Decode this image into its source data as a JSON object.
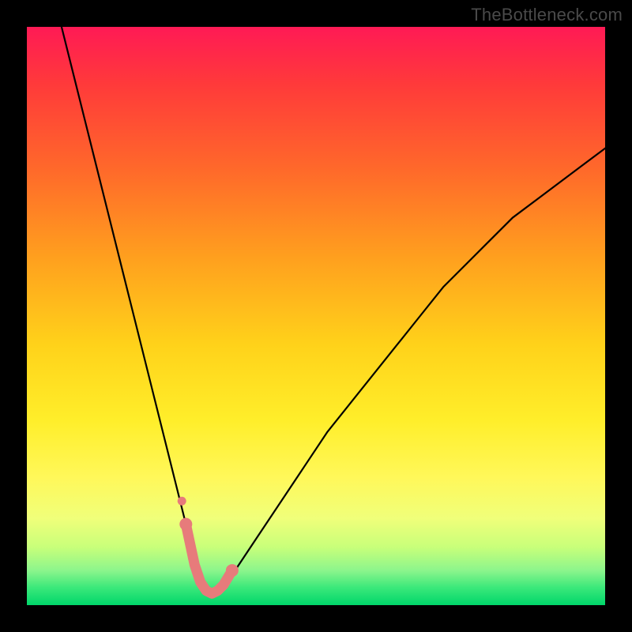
{
  "watermark": "TheBottleneck.com",
  "colors": {
    "frame": "#000000",
    "gradient_top": "#ff1a55",
    "gradient_bottom": "#00d66a",
    "curve": "#000000",
    "marker_fill": "#e77b7b",
    "marker_stroke": "#d65f5f"
  },
  "chart_data": {
    "type": "line",
    "title": "",
    "xlabel": "",
    "ylabel": "",
    "xlim": [
      0,
      100
    ],
    "ylim": [
      0,
      100
    ],
    "grid": false,
    "legend": false,
    "series": [
      {
        "name": "bottleneck-curve",
        "x": [
          6,
          8,
          10,
          12,
          14,
          16,
          18,
          20,
          22,
          24,
          26,
          27,
          28,
          29,
          30,
          31,
          32,
          33,
          34,
          35,
          36,
          38,
          40,
          44,
          48,
          52,
          56,
          60,
          64,
          68,
          72,
          76,
          80,
          84,
          88,
          92,
          96,
          100
        ],
        "y": [
          100,
          92,
          84,
          76,
          68,
          60,
          52,
          44,
          36,
          28,
          20,
          16,
          12,
          8,
          5,
          3,
          2,
          2,
          3,
          4,
          6,
          9,
          12,
          18,
          24,
          30,
          35,
          40,
          45,
          50,
          55,
          59,
          63,
          67,
          70,
          73,
          76,
          79
        ]
      }
    ],
    "markers": {
      "name": "highlighted-range",
      "x": [
        27.5,
        29,
        30,
        31,
        32,
        33,
        34,
        35.5
      ],
      "y": [
        14,
        7,
        4,
        2.5,
        2,
        2.5,
        3.5,
        6
      ]
    }
  }
}
